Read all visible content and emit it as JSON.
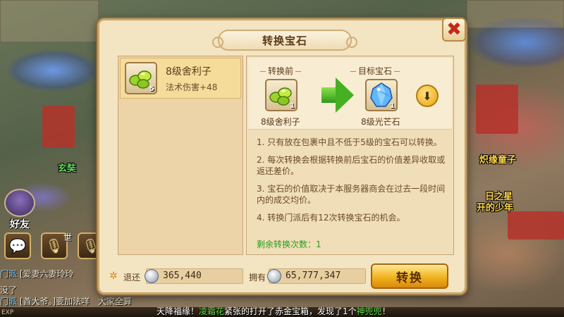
{
  "world": {
    "npc_names": [
      "玄奘",
      "炽缘童子",
      "日之星",
      "开的少年"
    ],
    "friend_label": "好友",
    "chat_lines": [
      {
        "tag": "门派",
        "text": "[爱妻六妻玲玲"
      },
      {
        "tag": "",
        "text": "没了"
      },
      {
        "tag": "门派",
        "text": "[酋大爷。]要加法咩"
      },
      {
        "tag": "",
        "text": "大家全算"
      }
    ],
    "hud_buttons": [
      {
        "icon": "speech-bubble-icon",
        "glyph": "💬",
        "label": ""
      },
      {
        "icon": "microphone-icon",
        "glyph": "🎙",
        "label": "世"
      },
      {
        "icon": "microphone-icon",
        "glyph": "🎙",
        "label": ""
      }
    ],
    "exp_label": "EXP",
    "broadcast": {
      "prefix": "天降福缘！",
      "name": "凌霜花",
      "middle": "紧张的打开了赤金宝箱，发现了1个",
      "item": "神兜兜",
      "suffix": "！"
    }
  },
  "dialog": {
    "title": "转换宝石",
    "close_glyph": "✖",
    "gem_list": [
      {
        "name": "8级舍利子",
        "desc": "法术伤害+48",
        "qty": "5",
        "icon": "green-sarira-gem-icon"
      }
    ],
    "convert": {
      "before_label": "转换前",
      "target_label": "目标宝石",
      "before_gem": {
        "name": "8级舍利子",
        "qty": "1",
        "icon": "green-sarira-gem-icon"
      },
      "target_gem": {
        "name": "8级光芒石",
        "qty": "1",
        "icon": "blue-radiant-stone-icon"
      },
      "arrow_icon": "green-right-arrow-icon",
      "dropdown_glyph": "⬇"
    },
    "rules": [
      "1. 只有放在包裹中且不低于5级的宝石可以转换。",
      "2. 每次转换会根据转换前后宝石的价值差异收取或返还差价。",
      "3. 宝石的价值取决于本服务器商会在过去一段时间内的成交均价。",
      "4. 转换门派后有12次转换宝石的机会。"
    ],
    "remaining": "剩余转换次数：1",
    "return_label": "退还",
    "return_value": "365,440",
    "own_label": "拥有",
    "own_value": "65,777,347",
    "convert_button": "转换"
  },
  "colors": {
    "panel_bg": "#f3e4c2",
    "accent_gold": "#f1b31f",
    "remain_green": "#2c9c1d",
    "close_red": "#c42a1c"
  }
}
